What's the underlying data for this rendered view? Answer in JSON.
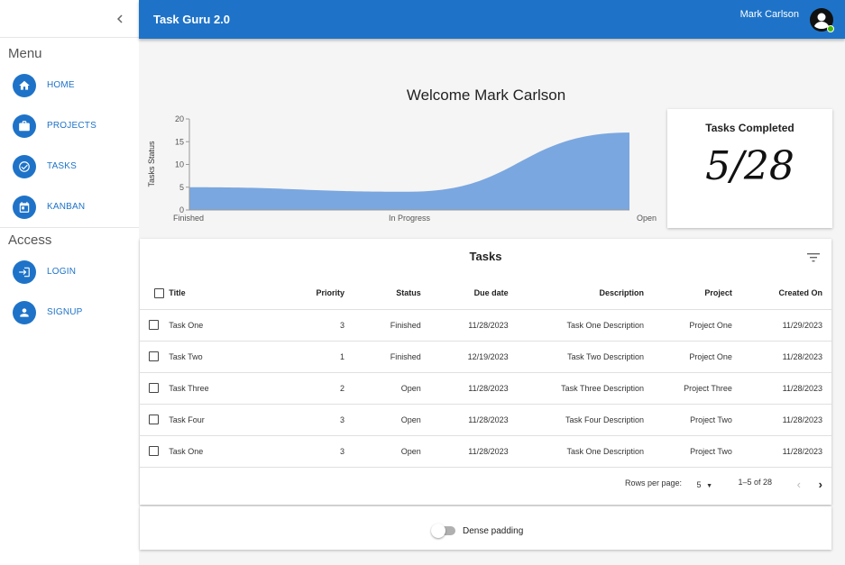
{
  "sidebar": {
    "collapse_icon": "chevron-left-icon",
    "menu_title": "Menu",
    "access_title": "Access",
    "menu_items": [
      {
        "label": "HOME",
        "icon": "home-icon"
      },
      {
        "label": "PROJECTS",
        "icon": "briefcase-icon"
      },
      {
        "label": "TASKS",
        "icon": "check-circle-icon"
      },
      {
        "label": "KANBAN",
        "icon": "calendar-icon"
      }
    ],
    "access_items": [
      {
        "label": "LOGIN",
        "icon": "login-icon"
      },
      {
        "label": "SIGNUP",
        "icon": "person-icon"
      }
    ]
  },
  "topbar": {
    "app_title": "Task Guru 2.0",
    "user_name": "Mark Carlson",
    "avatar_icon": "account-circle-icon",
    "status_color": "#44b700"
  },
  "colors": {
    "accent": "#1e73c8",
    "chart_fill": "#7aa7e0"
  },
  "welcome": "Welcome Mark Carlson",
  "chart_data": {
    "type": "area",
    "ylabel": "Tasks Status",
    "categories": [
      "Finished",
      "In Progress",
      "Open"
    ],
    "values": [
      5,
      4,
      17
    ],
    "yticks": [
      0,
      5,
      10,
      15,
      20
    ],
    "ylim": [
      0,
      20
    ]
  },
  "tasks_completed": {
    "title": "Tasks Completed",
    "value": "5/28"
  },
  "table": {
    "title": "Tasks",
    "filter_icon": "filter-list-icon",
    "headers": {
      "title": "Title",
      "priority": "Priority",
      "status": "Status",
      "due": "Due date",
      "description": "Description",
      "project": "Project",
      "created": "Created On"
    },
    "rows": [
      {
        "title": "Task One",
        "priority": "3",
        "status": "Finished",
        "due": "11/28/2023",
        "description": "Task One Description",
        "project": "Project One",
        "created": "11/29/2023"
      },
      {
        "title": "Task Two",
        "priority": "1",
        "status": "Finished",
        "due": "12/19/2023",
        "description": "Task Two Description",
        "project": "Project One",
        "created": "11/28/2023"
      },
      {
        "title": "Task Three",
        "priority": "2",
        "status": "Open",
        "due": "11/28/2023",
        "description": "Task Three Description",
        "project": "Project Three",
        "created": "11/28/2023"
      },
      {
        "title": "Task Four",
        "priority": "3",
        "status": "Open",
        "due": "11/28/2023",
        "description": "Task Four Description",
        "project": "Project Two",
        "created": "11/28/2023"
      },
      {
        "title": "Task One",
        "priority": "3",
        "status": "Open",
        "due": "11/28/2023",
        "description": "Task One Description",
        "project": "Project Two",
        "created": "11/28/2023"
      }
    ],
    "pagination": {
      "rows_per_page_label": "Rows per page:",
      "rows_per_page": "5",
      "range": "1–5 of 28",
      "prev_icon": "chevron-left-icon",
      "next_icon": "chevron-right-icon"
    }
  },
  "dense_padding": {
    "label": "Dense padding",
    "enabled": false
  }
}
